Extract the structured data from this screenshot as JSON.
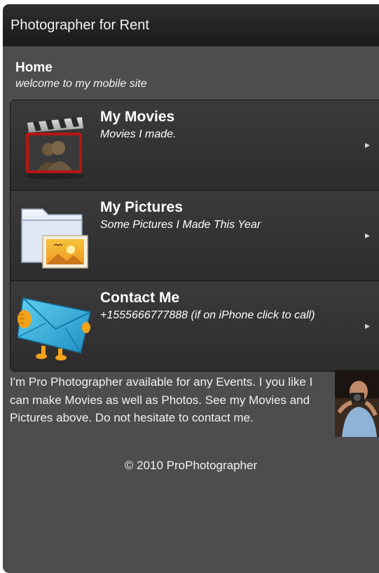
{
  "header": {
    "title": "Photographer for Rent"
  },
  "intro": {
    "title": "Home",
    "subtitle": "welcome to my mobile site"
  },
  "menu": {
    "items": [
      {
        "label": "My Movies",
        "desc": "Movies I made.",
        "icon": "film-clapperboard-icon"
      },
      {
        "label": "My Pictures",
        "desc": "Some Pictures I Made This Year",
        "icon": "picture-folder-icon"
      },
      {
        "label": "Contact Me",
        "desc": "+1555666777888 (if on iPhone click to call)",
        "icon": "mail-envelope-icon"
      }
    ]
  },
  "about": {
    "text": "I'm Pro Photographer available for any Events. I you like I can make Movies as well as Photos. See my Movies and Pictures above. Do not hesitate to contact me."
  },
  "footer": {
    "text": "© 2010 ProPhotographer"
  }
}
